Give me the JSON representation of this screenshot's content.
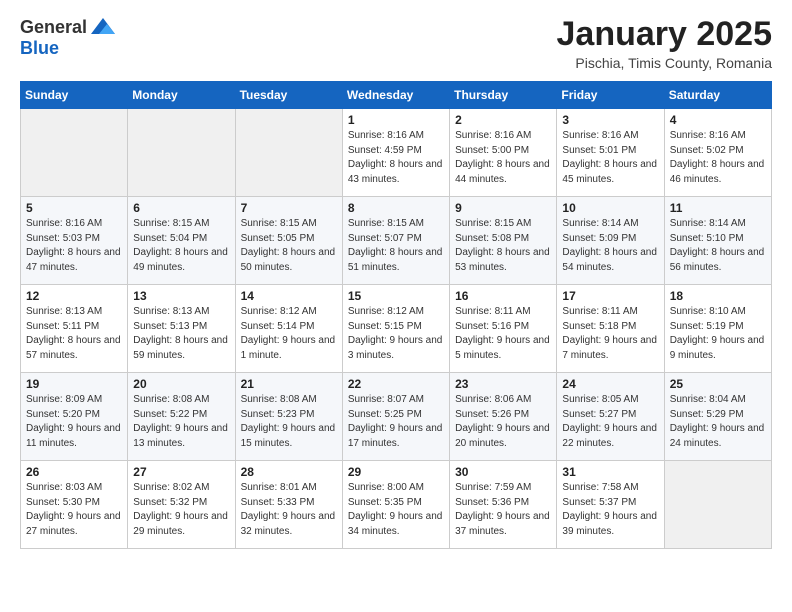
{
  "logo": {
    "general": "General",
    "blue": "Blue"
  },
  "header": {
    "title": "January 2025",
    "subtitle": "Pischia, Timis County, Romania"
  },
  "days_of_week": [
    "Sunday",
    "Monday",
    "Tuesday",
    "Wednesday",
    "Thursday",
    "Friday",
    "Saturday"
  ],
  "weeks": [
    [
      {
        "day": "",
        "empty": true
      },
      {
        "day": "",
        "empty": true
      },
      {
        "day": "",
        "empty": true
      },
      {
        "day": "1",
        "sunrise": "8:16 AM",
        "sunset": "4:59 PM",
        "daylight": "8 hours and 43 minutes."
      },
      {
        "day": "2",
        "sunrise": "8:16 AM",
        "sunset": "5:00 PM",
        "daylight": "8 hours and 44 minutes."
      },
      {
        "day": "3",
        "sunrise": "8:16 AM",
        "sunset": "5:01 PM",
        "daylight": "8 hours and 45 minutes."
      },
      {
        "day": "4",
        "sunrise": "8:16 AM",
        "sunset": "5:02 PM",
        "daylight": "8 hours and 46 minutes."
      }
    ],
    [
      {
        "day": "5",
        "sunrise": "8:16 AM",
        "sunset": "5:03 PM",
        "daylight": "8 hours and 47 minutes."
      },
      {
        "day": "6",
        "sunrise": "8:15 AM",
        "sunset": "5:04 PM",
        "daylight": "8 hours and 49 minutes."
      },
      {
        "day": "7",
        "sunrise": "8:15 AM",
        "sunset": "5:05 PM",
        "daylight": "8 hours and 50 minutes."
      },
      {
        "day": "8",
        "sunrise": "8:15 AM",
        "sunset": "5:07 PM",
        "daylight": "8 hours and 51 minutes."
      },
      {
        "day": "9",
        "sunrise": "8:15 AM",
        "sunset": "5:08 PM",
        "daylight": "8 hours and 53 minutes."
      },
      {
        "day": "10",
        "sunrise": "8:14 AM",
        "sunset": "5:09 PM",
        "daylight": "8 hours and 54 minutes."
      },
      {
        "day": "11",
        "sunrise": "8:14 AM",
        "sunset": "5:10 PM",
        "daylight": "8 hours and 56 minutes."
      }
    ],
    [
      {
        "day": "12",
        "sunrise": "8:13 AM",
        "sunset": "5:11 PM",
        "daylight": "8 hours and 57 minutes."
      },
      {
        "day": "13",
        "sunrise": "8:13 AM",
        "sunset": "5:13 PM",
        "daylight": "8 hours and 59 minutes."
      },
      {
        "day": "14",
        "sunrise": "8:12 AM",
        "sunset": "5:14 PM",
        "daylight": "9 hours and 1 minute."
      },
      {
        "day": "15",
        "sunrise": "8:12 AM",
        "sunset": "5:15 PM",
        "daylight": "9 hours and 3 minutes."
      },
      {
        "day": "16",
        "sunrise": "8:11 AM",
        "sunset": "5:16 PM",
        "daylight": "9 hours and 5 minutes."
      },
      {
        "day": "17",
        "sunrise": "8:11 AM",
        "sunset": "5:18 PM",
        "daylight": "9 hours and 7 minutes."
      },
      {
        "day": "18",
        "sunrise": "8:10 AM",
        "sunset": "5:19 PM",
        "daylight": "9 hours and 9 minutes."
      }
    ],
    [
      {
        "day": "19",
        "sunrise": "8:09 AM",
        "sunset": "5:20 PM",
        "daylight": "9 hours and 11 minutes."
      },
      {
        "day": "20",
        "sunrise": "8:08 AM",
        "sunset": "5:22 PM",
        "daylight": "9 hours and 13 minutes."
      },
      {
        "day": "21",
        "sunrise": "8:08 AM",
        "sunset": "5:23 PM",
        "daylight": "9 hours and 15 minutes."
      },
      {
        "day": "22",
        "sunrise": "8:07 AM",
        "sunset": "5:25 PM",
        "daylight": "9 hours and 17 minutes."
      },
      {
        "day": "23",
        "sunrise": "8:06 AM",
        "sunset": "5:26 PM",
        "daylight": "9 hours and 20 minutes."
      },
      {
        "day": "24",
        "sunrise": "8:05 AM",
        "sunset": "5:27 PM",
        "daylight": "9 hours and 22 minutes."
      },
      {
        "day": "25",
        "sunrise": "8:04 AM",
        "sunset": "5:29 PM",
        "daylight": "9 hours and 24 minutes."
      }
    ],
    [
      {
        "day": "26",
        "sunrise": "8:03 AM",
        "sunset": "5:30 PM",
        "daylight": "9 hours and 27 minutes."
      },
      {
        "day": "27",
        "sunrise": "8:02 AM",
        "sunset": "5:32 PM",
        "daylight": "9 hours and 29 minutes."
      },
      {
        "day": "28",
        "sunrise": "8:01 AM",
        "sunset": "5:33 PM",
        "daylight": "9 hours and 32 minutes."
      },
      {
        "day": "29",
        "sunrise": "8:00 AM",
        "sunset": "5:35 PM",
        "daylight": "9 hours and 34 minutes."
      },
      {
        "day": "30",
        "sunrise": "7:59 AM",
        "sunset": "5:36 PM",
        "daylight": "9 hours and 37 minutes."
      },
      {
        "day": "31",
        "sunrise": "7:58 AM",
        "sunset": "5:37 PM",
        "daylight": "9 hours and 39 minutes."
      },
      {
        "day": "",
        "empty": true
      }
    ]
  ],
  "labels": {
    "sunrise": "Sunrise:",
    "sunset": "Sunset:",
    "daylight": "Daylight:"
  }
}
